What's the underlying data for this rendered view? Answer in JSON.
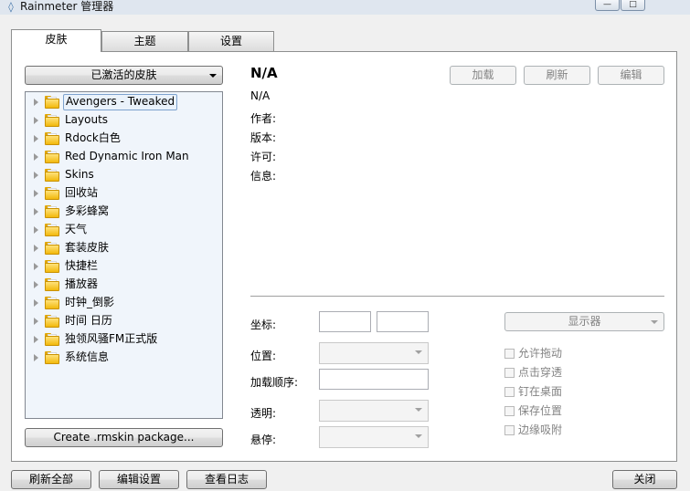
{
  "window": {
    "title": "Rainmeter 管理器",
    "controls": {
      "minimize": "—",
      "maximize": "□"
    }
  },
  "tabs": [
    {
      "label": "皮肤",
      "active": true
    },
    {
      "label": "主题",
      "active": false
    },
    {
      "label": "设置",
      "active": false
    }
  ],
  "skins_panel": {
    "dropdown_label": "已激活的皮肤",
    "tree": [
      {
        "label": "Avengers - Tweaked",
        "selected": true
      },
      {
        "label": "Layouts"
      },
      {
        "label": "Rdock白色"
      },
      {
        "label": "Red Dynamic Iron Man"
      },
      {
        "label": "Skins"
      },
      {
        "label": "回收站"
      },
      {
        "label": "多彩蜂窝"
      },
      {
        "label": "天气"
      },
      {
        "label": "套装皮肤"
      },
      {
        "label": "快捷栏"
      },
      {
        "label": "播放器"
      },
      {
        "label": "时钟_倒影"
      },
      {
        "label": "时间 日历"
      },
      {
        "label": "独领风骚FM正式版"
      },
      {
        "label": "系统信息"
      }
    ],
    "create_button": "Create .rmskin package..."
  },
  "details": {
    "name": "N/A",
    "subname": "N/A",
    "author_label": "作者:",
    "version_label": "版本:",
    "license_label": "许可:",
    "info_label": "信息:",
    "buttons": {
      "load": "加载",
      "refresh": "刷新",
      "edit": "编辑"
    }
  },
  "settings": {
    "coordinates_label": "坐标:",
    "position_label": "位置:",
    "load_order_label": "加载顺序:",
    "transparency_label": "透明:",
    "hover_label": "悬停:",
    "monitor_label": "显示器",
    "checkboxes": [
      {
        "label": "允许拖动",
        "checked": false
      },
      {
        "label": "点击穿透",
        "checked": false
      },
      {
        "label": "钉在桌面",
        "checked": false
      },
      {
        "label": "保存位置",
        "checked": false
      },
      {
        "label": "边缘吸附",
        "checked": false
      }
    ]
  },
  "footer": {
    "refresh_all": "刷新全部",
    "edit_settings": "编辑设置",
    "view_log": "查看日志",
    "close": "关闭"
  }
}
